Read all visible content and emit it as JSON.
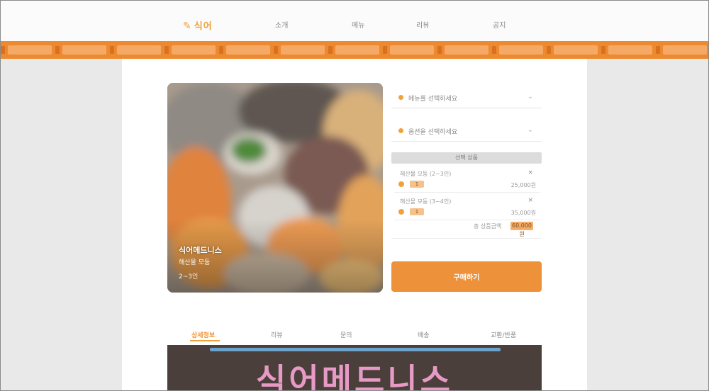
{
  "header": {
    "logo_mark": "✎",
    "logo_text": "식어",
    "nav": [
      "소개",
      "메뉴",
      "리뷰",
      "공지"
    ]
  },
  "ticker": {
    "segments": 13
  },
  "product": {
    "image_caption": "식어메드니스",
    "image_sub1": "해산물 모둠",
    "image_sub2": "2~3인"
  },
  "options": {
    "select_1": "메뉴를 선택하세요",
    "select_2": "옵션을 선택하세요",
    "chevron": "⌄",
    "cart_header": "선택 상품",
    "cart_items": [
      {
        "name": "해산물 모둠 (2~3인)",
        "qty": "1",
        "price": "25,000원",
        "remove": "×"
      },
      {
        "name": "해산물 모둠 (3~4인)",
        "qty": "1",
        "price": "35,000원",
        "remove": "×"
      }
    ],
    "total_label": "총 상품금액",
    "total_value": "60,000원"
  },
  "buy_button": "구매하기",
  "tabs": [
    "상세정보",
    "리뷰",
    "문의",
    "배송",
    "교환/반품"
  ],
  "banner": {
    "text": "식어메드니스"
  },
  "colors": {
    "accent": "#ed8a2f",
    "light_accent": "#f4a967"
  }
}
